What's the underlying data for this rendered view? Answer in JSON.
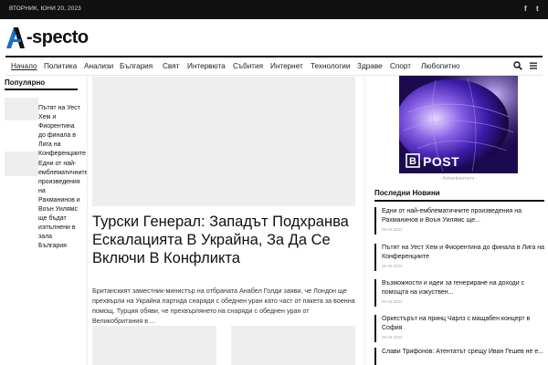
{
  "topbar": {
    "date": "ВТОРНИК, ЮНИ 20, 2023",
    "social": [
      {
        "icon": "facebook-icon",
        "glyph": "f"
      },
      {
        "icon": "twitter-icon",
        "glyph": "t"
      }
    ]
  },
  "logo": {
    "text": "-specto",
    "mark_color": "#1a6fc4"
  },
  "nav": {
    "items": [
      "Начало",
      "Политика",
      "Анализи",
      "България",
      "Свят",
      "Интервюта",
      "Събития",
      "Интернет",
      "Технологии",
      "Здраве",
      "Спорт",
      "Любопитно"
    ],
    "active": "Начало"
  },
  "sidebar": {
    "title": "Популярно",
    "items": [
      {
        "text": "Пътят на Уест Хем и Фиорентина до финала в Лига на Конференциите"
      },
      {
        "text": "Едни от най-емблематичните произведения на Рахманинов и Воън Уилямс ще бъдат изпълнени в зала България"
      }
    ]
  },
  "main": {
    "headline": "Турски Генерал: Западът Подхранва Ескалацията В Украйна, За Да Се Включи В Конфликта",
    "excerpt": "Британският заместник-министър на отбраната Анабел Голди заяви, че Лондон ще прехвърли на Украйна партида снаряди с обеднен уран като част от пакета за военна помощ.           Турция обяви, че прехвърлянето на снаряди с обеднен уран от Великобритания в           ..."
  },
  "ad": {
    "brand": "POST",
    "label": "- Advertisement -",
    "accent": "#1c0a4e"
  },
  "latest": {
    "title": "Последни Новини",
    "items": [
      {
        "title": "Едни от най-емблематичните произведения на Рахманинов и Воън Уилямс ще...",
        "date": "06.06.2022"
      },
      {
        "title": "Пътят на Уест Хем и Фиорентина до финала в Лига на Конференциите",
        "date": "06.06.2022"
      },
      {
        "title": "Възможности и идеи за генериране на доходи с помощта на изкуствен...",
        "date": "06.06.2022"
      },
      {
        "title": "Оркестърът на принц Чарлз с мащабен концерт в София",
        "date": "06.06.2022"
      },
      {
        "title": "Слави Трифонов: Атентатът срещу Иван Гешев не е..."
      }
    ]
  }
}
